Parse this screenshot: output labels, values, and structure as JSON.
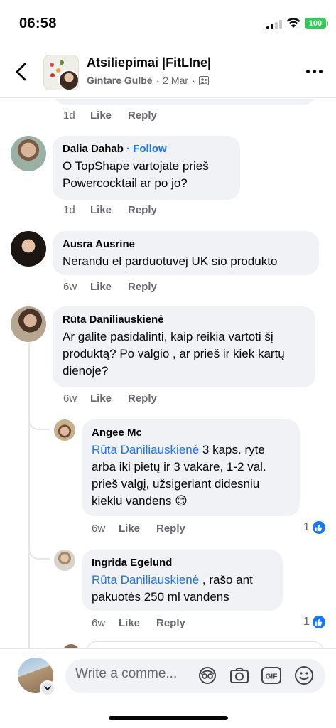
{
  "status_bar": {
    "time": "06:58",
    "battery": "100"
  },
  "header": {
    "title": "Atsiliepimai |FitLIne|",
    "author": "Gintare Gulbė",
    "separator": "·",
    "date": "2 Mar",
    "separator2": "·"
  },
  "previous_comment": {
    "time": "1d",
    "like": "Like",
    "reply": "Reply"
  },
  "comments": [
    {
      "name": "Dalia Dahab",
      "follow": "· Follow",
      "text": "O TopShape vartojate prieš Powercocktail ar po jo?",
      "time": "1d",
      "like": "Like",
      "reply": "Reply"
    },
    {
      "name": "Ausra Ausrine",
      "text": "Nerandu el parduotuvej UK sio produkto",
      "time": "6w",
      "like": "Like",
      "reply": "Reply"
    },
    {
      "name": "Rūta Daniliauskienė",
      "text": "Ar galite pasidalinti, kaip reikia vartoti šį produktą? Po valgio , ar prieš ir kiek kartų dienoje?",
      "time": "6w",
      "like": "Like",
      "reply": "Reply"
    }
  ],
  "replies": [
    {
      "name": "Angee Mc",
      "mention": "Rūta Daniliauskienė",
      "text": " 3 kaps. ryte arba iki pietų ir 3 vakare, 1-2 val. prieš valgį, užsigeriant didesniu kiekiu vandens 😊",
      "time": "6w",
      "like": "Like",
      "reply": "Reply",
      "reaction_count": "1"
    },
    {
      "name": "Ingrida Egelund",
      "mention": "Rūta Daniliauskienė",
      "text": " , rašo ant pakuotės 250 ml vandens",
      "time": "6w",
      "like": "Like",
      "reply": "Reply",
      "reaction_count": "1"
    }
  ],
  "composer": {
    "placeholder": "Write a comme..."
  },
  "icons": {
    "back": "chevron-left-icon",
    "more": "more-dots-icon",
    "members": "people-icon",
    "like": "thumbs-up-icon",
    "avatar_menu": "chevron-down-icon",
    "composer": [
      "avatar-sticker-icon",
      "camera-icon",
      "gif-icon",
      "emoji-icon"
    ]
  },
  "colors": {
    "accent": "#1b74e4",
    "bubble": "#f0f2f5",
    "muted": "#65676b",
    "like_blue": "#1877f2"
  }
}
